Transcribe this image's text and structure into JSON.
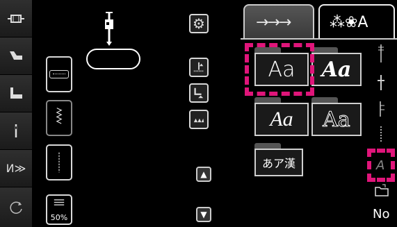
{
  "left_toolbar": {
    "icons": [
      "bobbin-icon",
      "presser-foot-icon",
      "stitch-foot-icon",
      "needle-icon",
      "thread-cutter-icon",
      "rotate-icon"
    ],
    "cutter_label": "И≫"
  },
  "stitch_panel": {
    "tension_percent": "50%"
  },
  "font_panel": {
    "tabs": [
      {
        "label": "→→→",
        "active": false
      },
      {
        "label": "⁂❀A",
        "active": true
      }
    ],
    "fonts": [
      {
        "label": "Aa",
        "style": "sans-thin",
        "selected": true
      },
      {
        "label": "Aa",
        "style": "script-bold",
        "selected": false
      },
      {
        "label": "Aa",
        "style": "cursive",
        "selected": false
      },
      {
        "label": "Aa",
        "style": "outline",
        "selected": false
      },
      {
        "label": "あア漢",
        "style": "japanese",
        "selected": false
      }
    ],
    "size_small_label": "A",
    "footer_label": "No",
    "highlight_color": "#e0157a"
  },
  "scroll": {
    "up": "▲",
    "down": "▼"
  }
}
